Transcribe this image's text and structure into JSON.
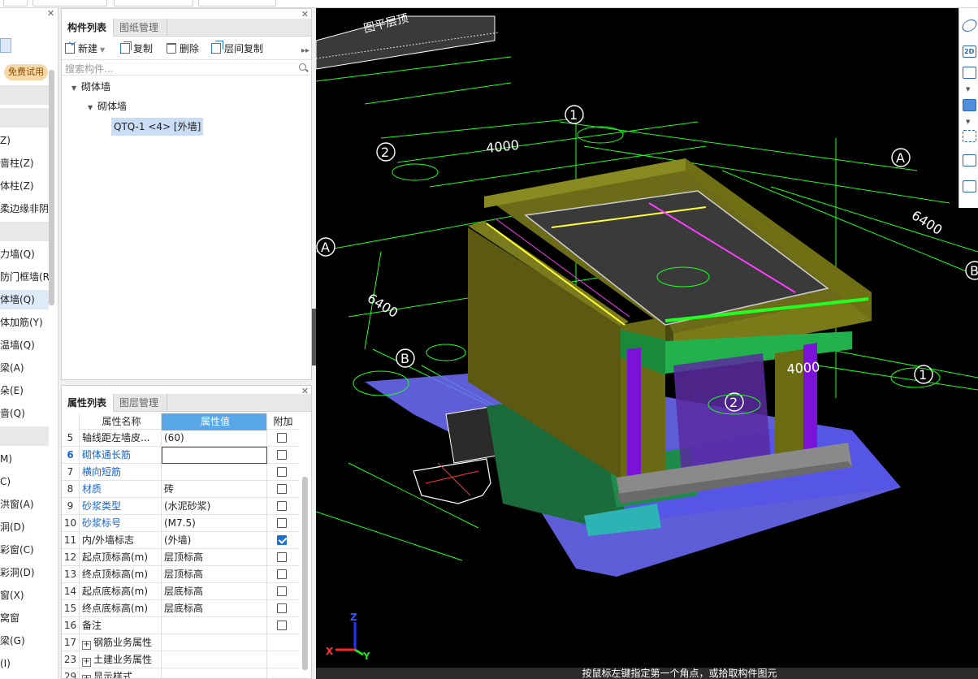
{
  "left_panel": {
    "trial_badge": "免费试用",
    "items": [
      {
        "label": "Z)"
      },
      {
        "label": "啬柱(Z)"
      },
      {
        "label": "体柱(Z)"
      },
      {
        "label": "柔边缘非阴"
      },
      {
        "label": "力墙(Q)"
      },
      {
        "label": "防门框墙(R"
      },
      {
        "label": "体墙(Q)"
      },
      {
        "label": "体加筋(Y)"
      },
      {
        "label": "温墙(Q)"
      },
      {
        "label": "梁(A)"
      },
      {
        "label": "朵(E)"
      },
      {
        "label": "啬(Q)"
      },
      {
        "label": "M)"
      },
      {
        "label": "C)"
      },
      {
        "label": "洪窗(A)"
      },
      {
        "label": "洞(D)"
      },
      {
        "label": "彩窗(C)"
      },
      {
        "label": "彩洞(D)"
      },
      {
        "label": "窗(X)"
      },
      {
        "label": "窝窗"
      },
      {
        "label": "梁(G)"
      },
      {
        "label": "(I)"
      }
    ]
  },
  "component_panel": {
    "tabs": [
      "构件列表",
      "图纸管理"
    ],
    "toolbar": {
      "new": "新建",
      "copy": "复制",
      "delete": "删除",
      "floor_copy": "层间复制"
    },
    "search_placeholder": "搜索构件...",
    "tree": {
      "root": "砌体墙",
      "child": "砌体墙",
      "leaf": "QTQ-1 <4> [外墙]"
    }
  },
  "property_panel": {
    "tabs": [
      "属性列表",
      "图层管理"
    ],
    "headers": {
      "name": "属性名称",
      "value": "属性值",
      "extra": "附加"
    },
    "rows": [
      {
        "num": "5",
        "name": "轴线距左墙皮...",
        "value": "(60)",
        "checked": false
      },
      {
        "num": "6",
        "name": "砌体通长筋",
        "value": "",
        "checked": false
      },
      {
        "num": "7",
        "name": "横向短筋",
        "value": "",
        "checked": false
      },
      {
        "num": "8",
        "name": "材质",
        "value": "砖",
        "checked": false
      },
      {
        "num": "9",
        "name": "砂浆类型",
        "value": "(水泥砂浆)",
        "checked": false
      },
      {
        "num": "10",
        "name": "砂浆标号",
        "value": "(M7.5)",
        "checked": false
      },
      {
        "num": "11",
        "name": "内/外墙标志",
        "value": "(外墙)",
        "checked": true
      },
      {
        "num": "12",
        "name": "起点顶标高(m)",
        "value": "层顶标高",
        "checked": false
      },
      {
        "num": "13",
        "name": "终点顶标高(m)",
        "value": "层顶标高",
        "checked": false
      },
      {
        "num": "14",
        "name": "起点底标高(m)",
        "value": "层底标高",
        "checked": false
      },
      {
        "num": "15",
        "name": "终点底标高(m)",
        "value": "层底标高",
        "checked": false
      },
      {
        "num": "16",
        "name": "备注",
        "value": "",
        "checked": false
      },
      {
        "num": "17",
        "name": "钢筋业务属性",
        "value": "",
        "checked": null
      },
      {
        "num": "23",
        "name": "土建业务属性",
        "value": "",
        "checked": null
      },
      {
        "num": "29",
        "name": "显示样式",
        "value": "",
        "checked": null
      }
    ]
  },
  "viewport": {
    "dimensions": {
      "d4000_top": "4000",
      "d6400_left": "6400",
      "d6400_right": "6400",
      "d4000_right": "4000"
    },
    "axes": {
      "a1_top": "1",
      "a2": "2",
      "aA_top": "A",
      "aA_left": "A",
      "aB_left": "B",
      "aB_right": "B",
      "a1_right": "1",
      "a2_bottom": "2"
    },
    "axis_triad": {
      "x": "X",
      "y": "Y",
      "z": "Z"
    },
    "status": "按鼠标左键指定第一个角点，或拾取构件图元",
    "tools": {
      "t2d": "2D"
    }
  }
}
